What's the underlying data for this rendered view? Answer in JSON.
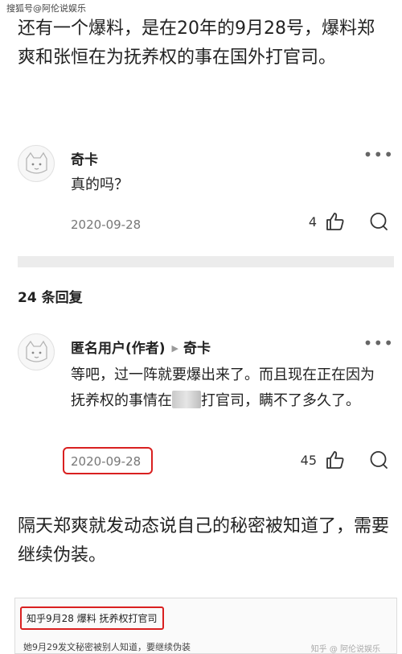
{
  "watermark": "搜狐号@阿伦说娱乐",
  "article": {
    "paragraph1": "还有一个爆料，是在20年的9月28号，爆料郑爽和张恒在为抚养权的事在国外打官司。",
    "paragraph2": "隔天郑爽就发动态说自己的秘密被知道了，需要继续伪装。"
  },
  "comment": {
    "author": "奇卡",
    "text": "真的吗？",
    "date": "2020-09-28",
    "likes": "4",
    "more": "•••"
  },
  "replies": {
    "count_label": "24 条回复"
  },
  "reply": {
    "author": "匿名用户(作者)",
    "reply_to": "奇卡",
    "text_part1": "等吧，过一阵就要爆出来了。而且现在正在因为抚养权的事情在",
    "text_part2": "打官司，瞒不了多久了。",
    "date": "2020-09-28",
    "likes": "45",
    "more": "•••"
  },
  "embed": {
    "title": "知乎9月28 爆料 抚养权打官司",
    "line": "她9月29发文秘密被别人知道，要继续伪装",
    "source": "知乎 @ 阿伦说娱乐"
  },
  "colors": {
    "highlight_red": "#d92020",
    "divider": "#ececec"
  },
  "icons": {
    "avatar": "dog-avatar-icon",
    "like": "thumbs-up-icon",
    "comment": "speech-bubble-icon",
    "more": "more-dots-icon"
  }
}
